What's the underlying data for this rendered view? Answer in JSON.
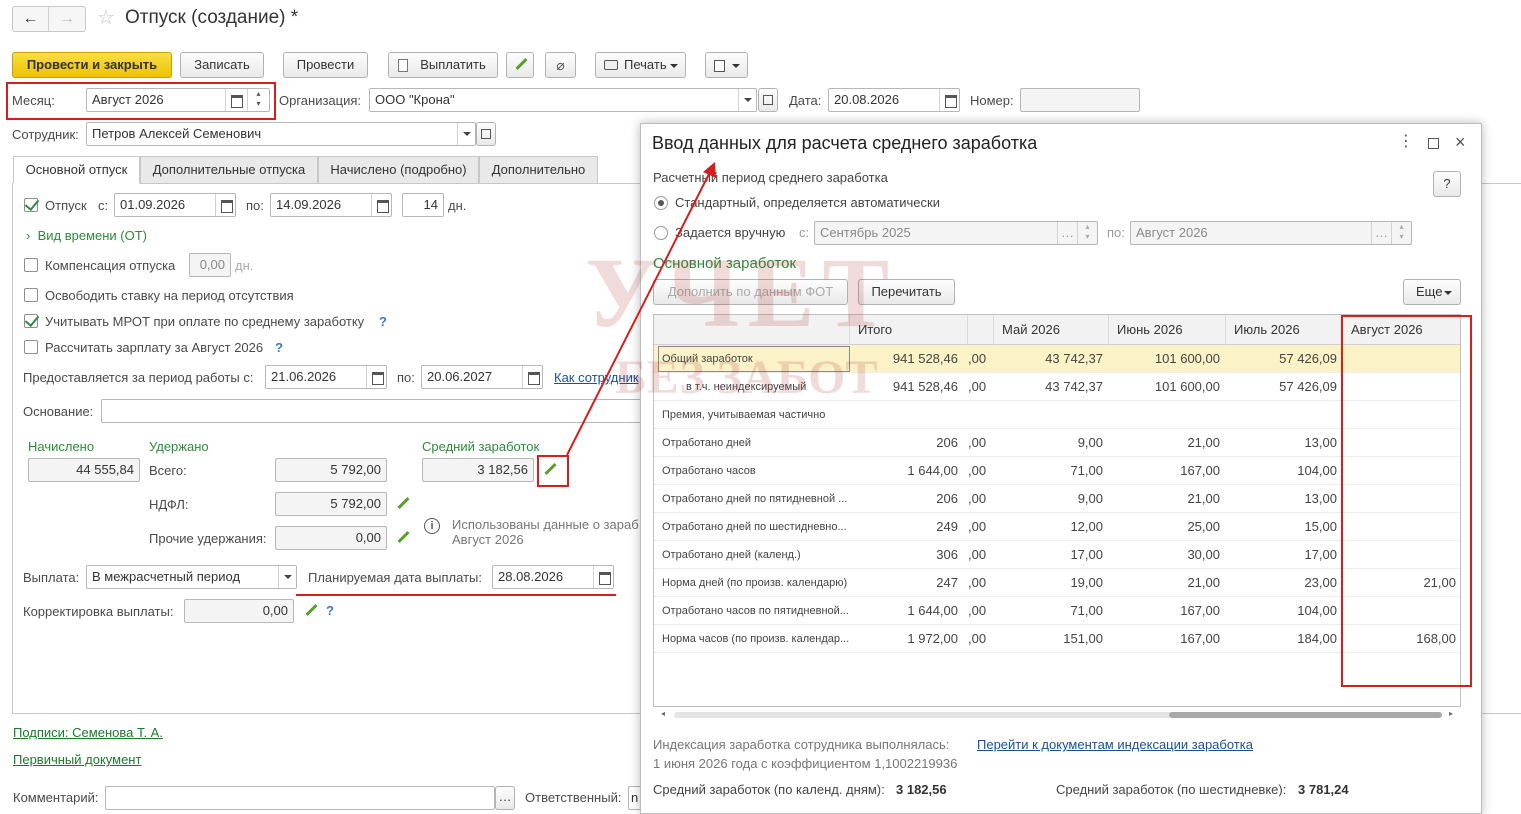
{
  "header": {
    "title": "Отпуск (создание) *"
  },
  "toolbar": {
    "post_close": "Провести и закрыть",
    "save": "Записать",
    "post": "Провести",
    "pay": "Выплатить",
    "print": "Печать"
  },
  "form": {
    "month_label": "Месяц:",
    "month_value": "Август 2026",
    "org_label": "Организация:",
    "org_value": "ООО \"Крона\"",
    "date_label": "Дата:",
    "date_value": "20.08.2026",
    "number_label": "Номер:",
    "number_value": "",
    "employee_label": "Сотрудник:",
    "employee_value": "Петров Алексей Семенович"
  },
  "tabs": [
    "Основной отпуск",
    "Дополнительные отпуска",
    "Начислено (подробно)",
    "Дополнительно"
  ],
  "main_tab": {
    "vacation_label": "Отпуск",
    "from_label": "с:",
    "from_value": "01.09.2026",
    "to_label": "по:",
    "to_value": "14.09.2026",
    "days_value": "14",
    "days_unit": "дн.",
    "time_kind": "Вид времени (ОТ)",
    "compensation_label": "Компенсация отпуска",
    "compensation_value": "0,00",
    "compensation_unit": "дн.",
    "free_rate": "Освободить ставку на период отсутствия",
    "mrot": "Учитывать МРОТ при оплате по среднему заработку",
    "calc_salary": "Рассчитать зарплату за Август 2026",
    "period_label": "Предоставляется за период работы с:",
    "period_from": "21.06.2026",
    "period_to_label": "по:",
    "period_to": "20.06.2027",
    "period_link": "Как сотрудник",
    "basis_label": "Основание:",
    "basis_value": "",
    "accrued_label": "Начислено",
    "accrued_value": "44 555,84",
    "withheld_label": "Удержано",
    "total_label": "Всего:",
    "total_value": "5 792,00",
    "ndfl_label": "НДФЛ:",
    "ndfl_value": "5 792,00",
    "other_label": "Прочие удержания:",
    "other_value": "0,00",
    "avg_label": "Средний заработок",
    "avg_value": "3 182,56",
    "info_text_1": "Использованы данные о зараб",
    "info_text_2": "Август 2026",
    "payout_label": "Выплата:",
    "payout_value": "В межрасчетный период",
    "planned_label": "Планируемая дата выплаты:",
    "planned_value": "28.08.2026",
    "correction_label": "Корректировка выплаты:",
    "correction_value": "0,00"
  },
  "footer": {
    "signatures": "Подписи: Семенова Т. А.",
    "primary_doc": "Первичный документ",
    "comment_label": "Комментарий:",
    "comment_value": "",
    "responsible_label": "Ответственный:",
    "responsible_value": "n"
  },
  "dialog": {
    "title": "Ввод данных для расчета среднего заработка",
    "period_section": "Расчетный период среднего заработка",
    "radio_standard": "Стандартный, определяется автоматически",
    "radio_manual": "Задается вручную",
    "manual_from_label": "с:",
    "manual_from": "Сентябрь 2025",
    "manual_to_label": "по:",
    "manual_to": "Август 2026",
    "basic_section": "Основной заработок",
    "fill_btn": "Дополнить по данным ФОТ",
    "recalc_btn": "Перечитать",
    "more_btn": "Еще",
    "help_btn": "?",
    "columns": [
      "",
      "Итого",
      "",
      "Май 2026",
      "Июнь 2026",
      "Июль 2026",
      "Август 2026"
    ],
    "rows": [
      {
        "name": "Общий заработок",
        "total": "941 528,46",
        "dec": ",00",
        "may": "43 742,37",
        "jun": "101 600,00",
        "jul": "57 426,09",
        "aug": ""
      },
      {
        "name": "в т.ч. неиндексируемый",
        "total": "941 528,46",
        "dec": ",00",
        "may": "43 742,37",
        "jun": "101 600,00",
        "jul": "57 426,09",
        "aug": ""
      },
      {
        "name": "Премия, учитываемая частично",
        "total": "",
        "dec": "",
        "may": "",
        "jun": "",
        "jul": "",
        "aug": ""
      },
      {
        "name": "Отработано дней",
        "total": "206",
        "dec": ",00",
        "may": "9,00",
        "jun": "21,00",
        "jul": "13,00",
        "aug": ""
      },
      {
        "name": "Отработано часов",
        "total": "1 644,00",
        "dec": ",00",
        "may": "71,00",
        "jun": "167,00",
        "jul": "104,00",
        "aug": ""
      },
      {
        "name": "Отработано дней по пятидневной ...",
        "total": "206",
        "dec": ",00",
        "may": "9,00",
        "jun": "21,00",
        "jul": "13,00",
        "aug": ""
      },
      {
        "name": "Отработано дней по шестидневно...",
        "total": "249",
        "dec": ",00",
        "may": "12,00",
        "jun": "25,00",
        "jul": "15,00",
        "aug": ""
      },
      {
        "name": "Отработано дней (календ.)",
        "total": "306",
        "dec": ",00",
        "may": "17,00",
        "jun": "30,00",
        "jul": "17,00",
        "aug": ""
      },
      {
        "name": "Норма дней (по произв. календарю)",
        "total": "247",
        "dec": ",00",
        "may": "19,00",
        "jun": "21,00",
        "jul": "23,00",
        "aug": "21,00"
      },
      {
        "name": "Отработано часов по пятидневной...",
        "total": "1 644,00",
        "dec": ",00",
        "may": "71,00",
        "jun": "167,00",
        "jul": "104,00",
        "aug": ""
      },
      {
        "name": "Норма часов (по произв. календар...",
        "total": "1 972,00",
        "dec": ",00",
        "may": "151,00",
        "jun": "167,00",
        "jul": "184,00",
        "aug": "168,00"
      }
    ],
    "indexation_text": "Индексация заработка сотрудника выполнялась:",
    "indexation_link": "Перейти к документам индексации заработка",
    "indexation_detail": "1 июня 2026 года с коэффициентом 1,1002219936",
    "avg_calendar_label": "Средний заработок (по календ. дням):",
    "avg_calendar_value": "3 182,56",
    "avg_six_label": "Средний заработок (по шестидневке):",
    "avg_six_value": "3 781,24"
  },
  "watermark": {
    "line1": "УЧЕТ",
    "line2": "БЕЗ ЗАБОТ"
  }
}
